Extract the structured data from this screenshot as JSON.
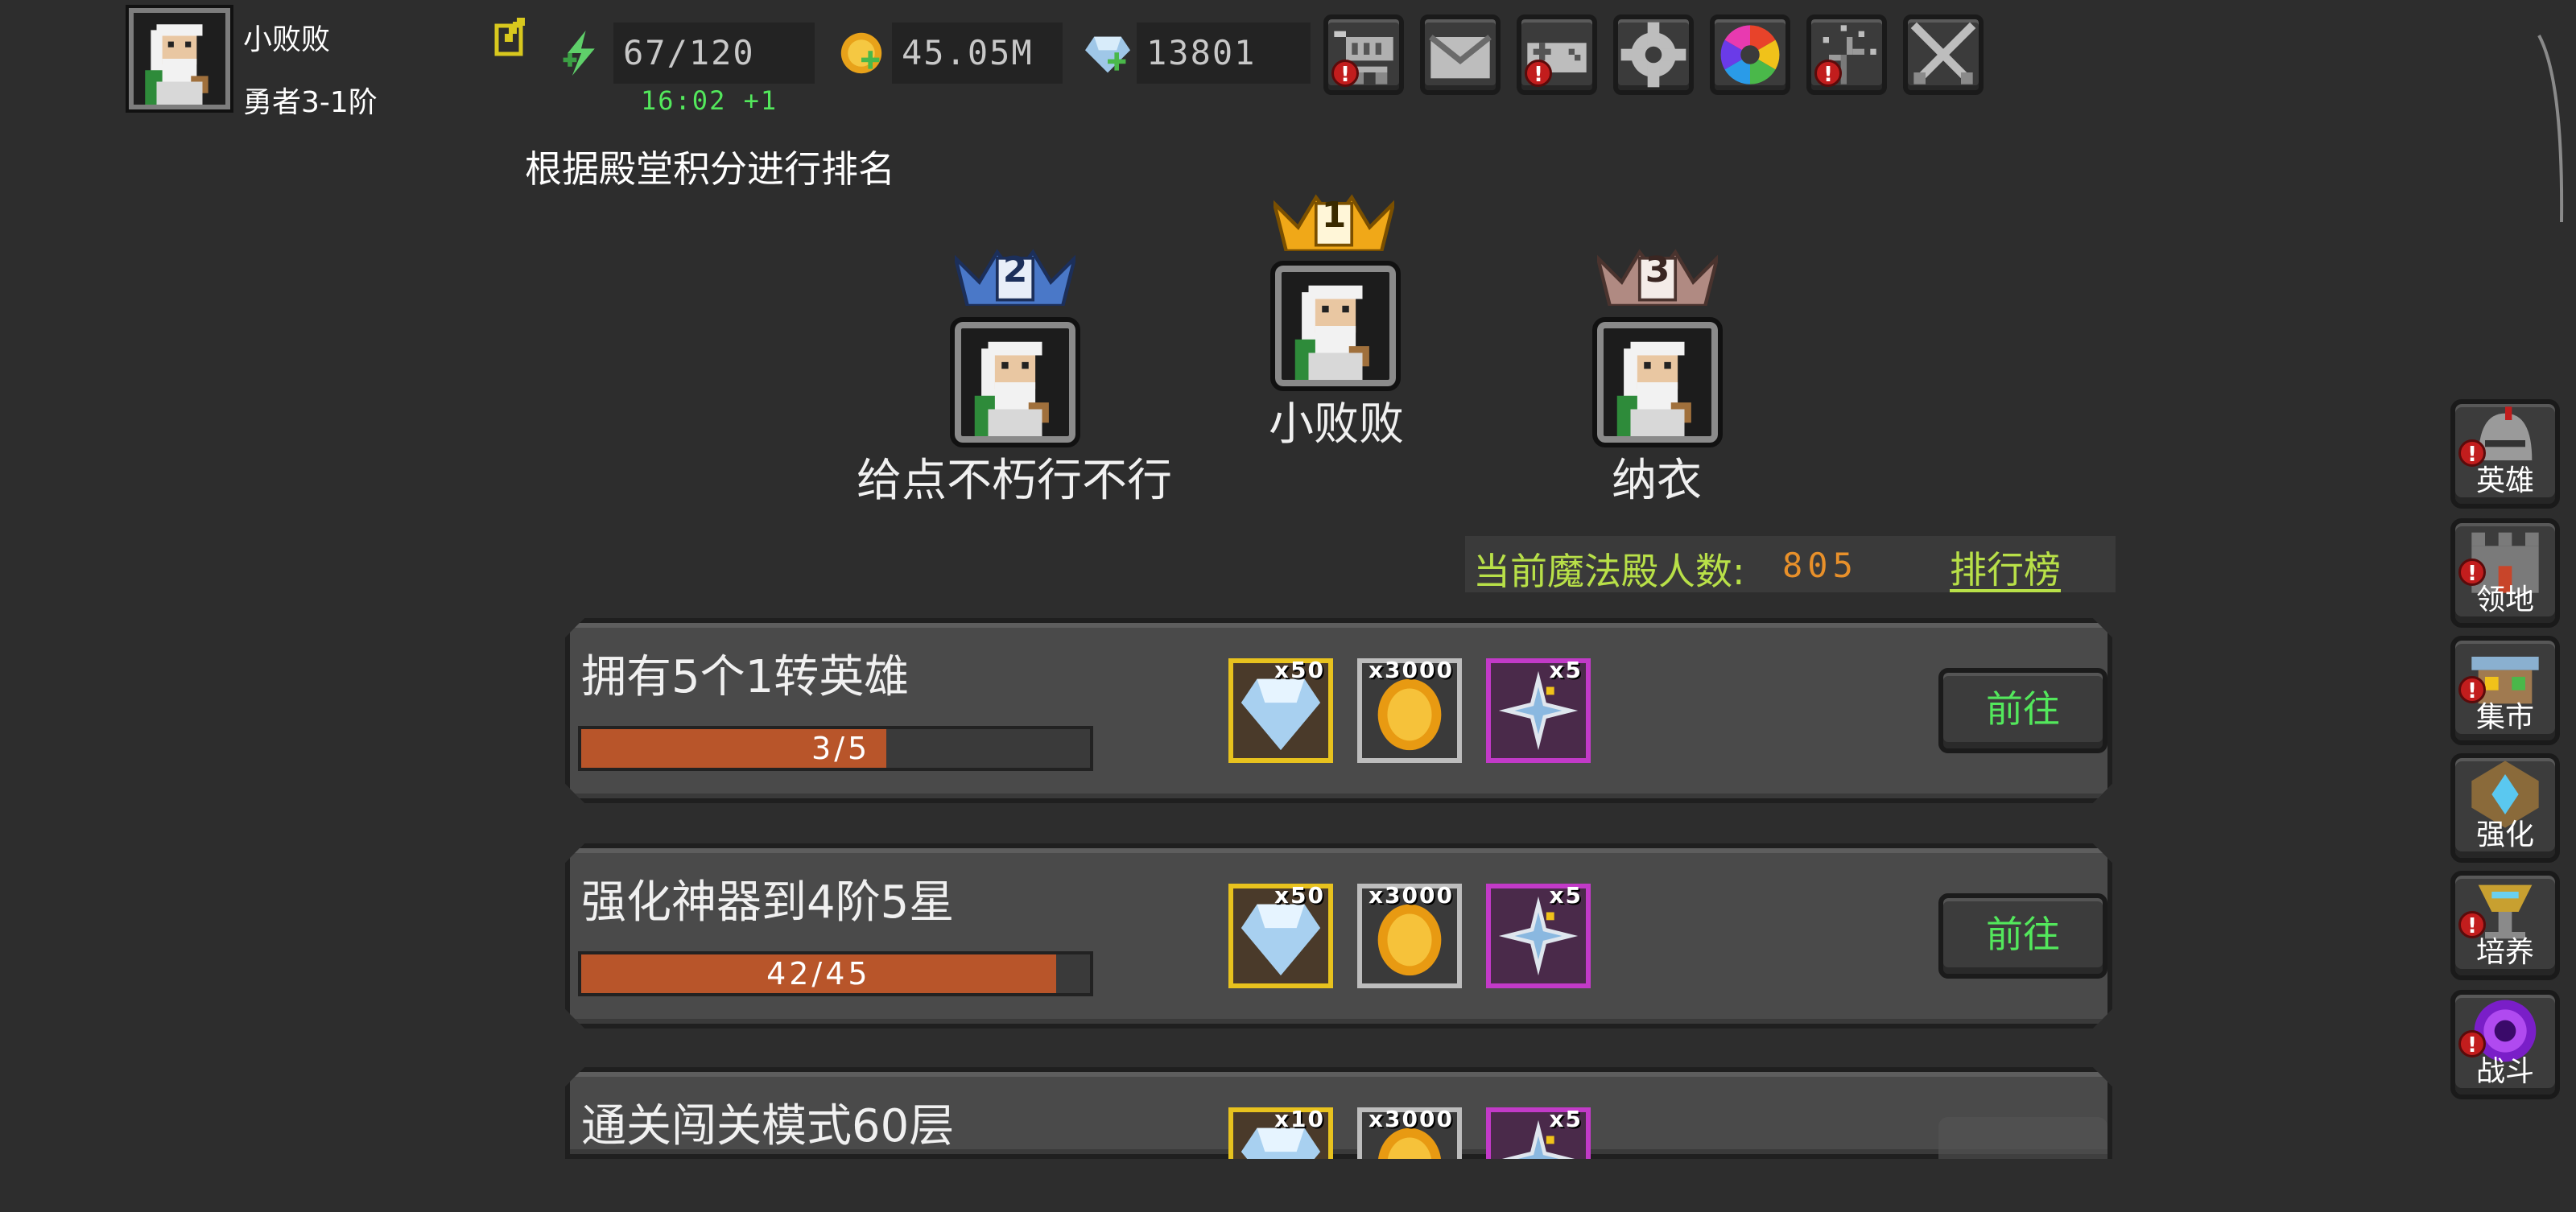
{
  "player": {
    "name": "小败败",
    "rank": "勇者3-1阶"
  },
  "resources": {
    "energy": "67/120",
    "energy_timer": "16:02 +1",
    "gold": "45.05M",
    "gems": "13801"
  },
  "colors": {
    "accent_green": "#53e85c",
    "progress_orange": "#b8552a",
    "count_orange": "#e8902a",
    "badge_red": "#c21d1d",
    "bg": "#2d2d2d"
  },
  "top_buttons": [
    {
      "icon": "shop-cart-icon",
      "alert": true
    },
    {
      "icon": "mail-icon",
      "alert": false
    },
    {
      "icon": "gamepad-icon",
      "alert": true
    },
    {
      "icon": "gear-icon",
      "alert": false
    },
    {
      "icon": "color-wheel-icon",
      "alert": false
    },
    {
      "icon": "fireworks-icon",
      "alert": true
    },
    {
      "icon": "crossed-swords-icon",
      "alert": false
    }
  ],
  "alert_mark": "!",
  "ranking": {
    "caption": "根据殿堂积分进行排名",
    "podium": [
      {
        "place": "1",
        "name": "小败败"
      },
      {
        "place": "2",
        "name": "给点不朽行不行"
      },
      {
        "place": "3",
        "name": "纳衣"
      }
    ],
    "count_label": "当前魔法殿人数:",
    "count_value": "805",
    "leaderboard_link": "排行榜"
  },
  "tasks": [
    {
      "title": "拥有5个1转英雄",
      "progress_text": "3/5",
      "progress": 0.6,
      "rewards": [
        {
          "icon": "diamond-icon",
          "count": "x50"
        },
        {
          "icon": "gold-coin-icon",
          "count": "x3000"
        },
        {
          "icon": "star-shard-icon",
          "count": "x5"
        }
      ],
      "button": "前往"
    },
    {
      "title": "强化神器到4阶5星",
      "progress_text": "42/45",
      "progress": 0.933,
      "rewards": [
        {
          "icon": "diamond-icon",
          "count": "x50"
        },
        {
          "icon": "gold-coin-icon",
          "count": "x3000"
        },
        {
          "icon": "star-shard-icon",
          "count": "x5"
        }
      ],
      "button": "前往"
    },
    {
      "title": "通关闯关模式60层",
      "rewards": [
        {
          "icon": "diamond-icon",
          "count": "x10"
        },
        {
          "icon": "gold-coin-icon",
          "count": "x3000"
        },
        {
          "icon": "star-shard-icon",
          "count": "x5"
        }
      ]
    }
  ],
  "side_menu": [
    {
      "label": "英雄",
      "icon": "helmet-icon",
      "alert": true
    },
    {
      "label": "领地",
      "icon": "castle-icon",
      "alert": true
    },
    {
      "label": "集市",
      "icon": "market-stall-icon",
      "alert": true
    },
    {
      "label": "强化",
      "icon": "crystal-emblem-icon",
      "alert": false
    },
    {
      "label": "培养",
      "icon": "chalice-icon",
      "alert": true
    },
    {
      "label": "战斗",
      "icon": "portal-icon",
      "alert": true
    }
  ]
}
